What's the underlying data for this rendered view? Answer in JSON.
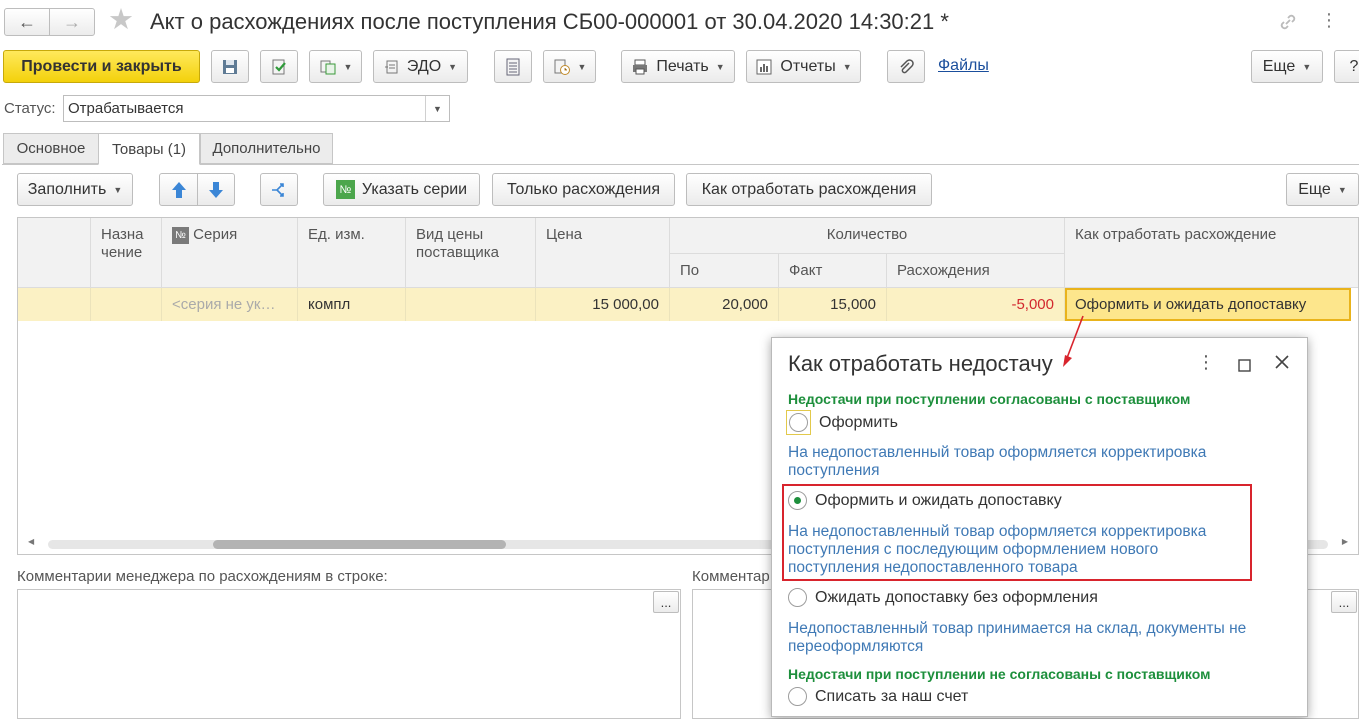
{
  "window": {
    "title": "Акт о расхождениях после поступления СБ00-000001 от 30.04.2020 14:30:21 *"
  },
  "toolbar": {
    "post_close": "Провести и закрыть",
    "edo": "ЭДО",
    "print": "Печать",
    "reports": "Отчеты",
    "files": "Файлы",
    "more": "Еще",
    "help": "?"
  },
  "status": {
    "label": "Статус:",
    "value": "Отрабатывается"
  },
  "tabs": [
    {
      "label": "Основное"
    },
    {
      "label": "Товары (1)"
    },
    {
      "label": "Дополнительно"
    }
  ],
  "goods_toolbar": {
    "fill": "Заполнить",
    "series_glyph": "№",
    "set_series": "Указать серии",
    "only_diff": "Только расхождения",
    "how_process": "Как отработать расхождения",
    "more": "Еще"
  },
  "table": {
    "headers": {
      "purpose": "Назна\nчение",
      "series": "Серия",
      "unit": "Ед. изм.",
      "price_type": "Вид цены поставщика",
      "price": "Цена",
      "quantity": "Количество",
      "qty_doc": "По",
      "qty_fact": "Факт",
      "qty_diff": "Расхождения",
      "how": "Как отработать расхождение"
    },
    "rows": [
      {
        "purpose": "",
        "series": "<серия не ук…",
        "unit": "компл",
        "price_type": "",
        "price": "15 000,00",
        "qty_doc": "20,000",
        "qty_fact": "15,000",
        "qty_diff": "-5,000",
        "how": "Оформить и ожидать допоставку"
      }
    ]
  },
  "comments": {
    "manager_label": "Комментарии менеджера по расхождениям в строке:",
    "second_label": "Комментар",
    "dots": "..."
  },
  "popup": {
    "title": "Как отработать недостачу",
    "group_agreed": "Недостачи при поступлении согласованы с поставщиком",
    "opt1": "Оформить",
    "opt1_desc": "На недопоставленный товар оформляется корректировка поступления",
    "opt2": "Оформить и ожидать допоставку",
    "opt2_desc": "На недопоставленный товар оформляется корректировка поступления с последующим оформлением нового поступления недопоставленного товара",
    "opt3": "Ожидать допоставку без оформления",
    "opt3_desc": "Недопоставленный товар принимается на склад, документы не переоформляются",
    "group_not_agreed": "Недостачи при поступлении не согласованы с поставщиком",
    "opt4": "Списать за наш счет",
    "selected_option": "opt2"
  },
  "colors": {
    "primary_button": "#f3d10b",
    "selected_row": "#fbf1c4",
    "negative": "#d2282e",
    "group_heading": "#1d8f3c",
    "description": "#3f79b5",
    "highlight_box": "#d8242d"
  }
}
